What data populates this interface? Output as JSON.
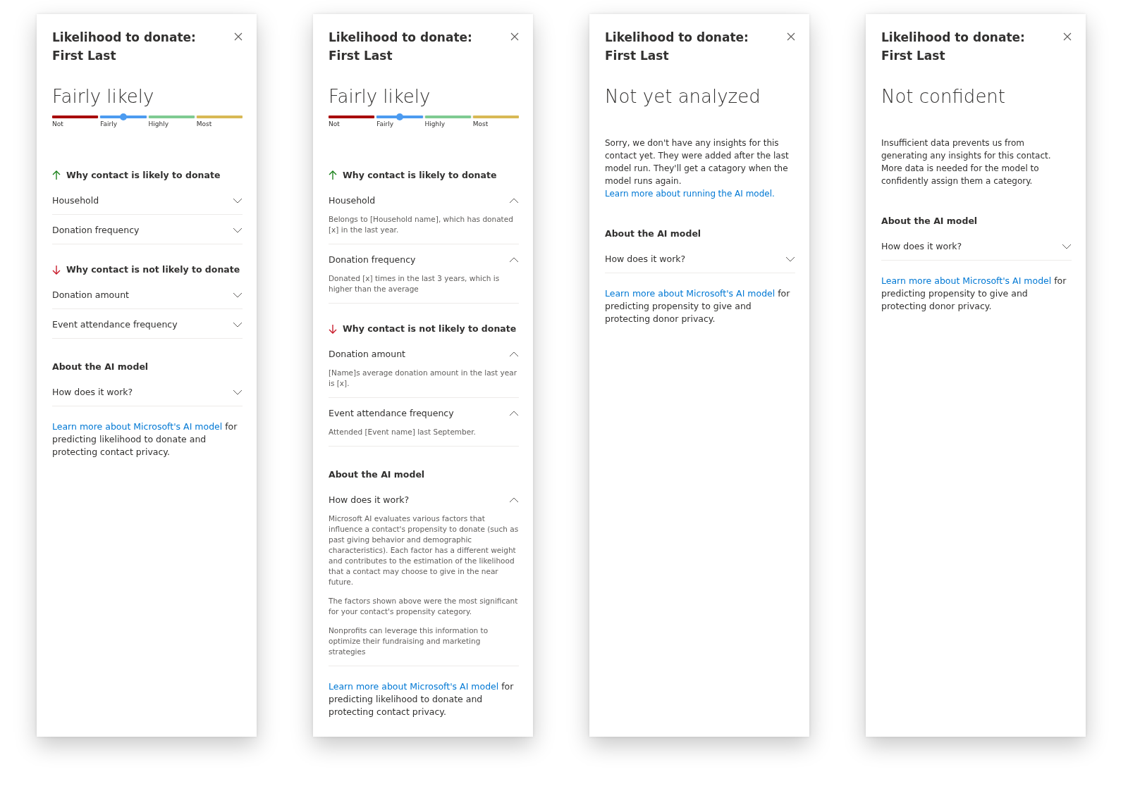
{
  "panels": [
    {
      "title": [
        "Likelihood to donate:",
        "First Last"
      ],
      "status": "Fairly likely",
      "scale": {
        "level": 0.375,
        "segments": [
          {
            "label": "Not",
            "color": "#a80000"
          },
          {
            "label": "Fairly",
            "color": "#4c9bf0"
          },
          {
            "label": "Highly",
            "color": "#7fcb92"
          },
          {
            "label": "Most",
            "color": "#d8b955"
          }
        ]
      },
      "sections": [
        {
          "kind": "likely",
          "heading": "Why contact is likely to donate",
          "items": [
            {
              "label": "Household",
              "expanded": false
            },
            {
              "label": "Donation frequency",
              "expanded": false
            }
          ]
        },
        {
          "kind": "unlikely",
          "heading": "Why contact is not likely to donate",
          "items": [
            {
              "label": "Donation amount",
              "expanded": false
            },
            {
              "label": "Event attendance frequency",
              "expanded": false
            }
          ]
        },
        {
          "kind": "about",
          "heading": "About the AI model",
          "items": [
            {
              "label": "How does it work?",
              "expanded": false
            }
          ]
        }
      ],
      "footer": [
        {
          "kind": "link",
          "text": "Learn more about Microsoft's AI model"
        },
        {
          "kind": "text",
          "text": " for predicting likelihood to donate and protecting contact privacy."
        }
      ]
    },
    {
      "title": [
        "Likelihood to donate:",
        "First Last"
      ],
      "status": "Fairly likely",
      "scale": {
        "level": 0.375,
        "segments": [
          {
            "label": "Not",
            "color": "#a80000"
          },
          {
            "label": "Fairly",
            "color": "#4c9bf0"
          },
          {
            "label": "Highly",
            "color": "#7fcb92"
          },
          {
            "label": "Most",
            "color": "#d8b955"
          }
        ]
      },
      "sections": [
        {
          "kind": "likely",
          "heading": "Why contact is likely to donate",
          "items": [
            {
              "label": "Household",
              "expanded": true,
              "detail": [
                "Belongs to [Household name], which has donated [x] in the last year."
              ]
            },
            {
              "label": "Donation frequency",
              "expanded": true,
              "detail": [
                "Donated [x] times in the last 3 years, which is higher than the average"
              ]
            }
          ]
        },
        {
          "kind": "unlikely",
          "heading": "Why contact is not likely to donate",
          "items": [
            {
              "label": "Donation amount",
              "expanded": true,
              "detail": [
                "[Name]s average donation amount in the last year is [x]."
              ]
            },
            {
              "label": "Event attendance frequency",
              "expanded": true,
              "detail": [
                "Attended [Event name] last September."
              ]
            }
          ]
        },
        {
          "kind": "about",
          "heading": "About the AI model",
          "items": [
            {
              "label": "How does it work?",
              "expanded": true,
              "detail": [
                "Microsoft AI evaluates various factors that influence a contact's propensity to donate (such as past giving behavior and demographic characteristics). Each factor has a different weight and contributes to the estimation of the likelihood that a contact may choose to give in the near future.",
                "The factors shown above were the most significant for your contact's propensity category.",
                "Nonprofits can leverage this information to optimize their fundraising and marketing strategies"
              ]
            }
          ]
        }
      ],
      "footer": [
        {
          "kind": "link",
          "text": "Learn more about Microsoft's AI model"
        },
        {
          "kind": "text",
          "text": " for predicting likelihood to donate and protecting contact privacy."
        }
      ]
    },
    {
      "title": [
        "Likelihood to donate:",
        "First Last"
      ],
      "status": "Not yet analyzed",
      "message": [
        {
          "kind": "text",
          "text": "Sorry, we don't have any insights for this contact yet.  They were added after the last model run. They'll get a catagory when the model runs again. "
        },
        {
          "kind": "link",
          "text": "Learn more about running"
        },
        {
          "kind": "link",
          "text": "the AI model."
        }
      ],
      "sections": [
        {
          "kind": "about",
          "heading": "About the AI model",
          "items": [
            {
              "label": "How does it work?",
              "expanded": false
            }
          ]
        }
      ],
      "footer": [
        {
          "kind": "link",
          "text": "Learn more about Microsoft's AI model"
        },
        {
          "kind": "text",
          "text": " for predicting propensity to give and protecting donor privacy."
        }
      ]
    },
    {
      "title": [
        "Likelihood to donate:",
        "First Last"
      ],
      "status": "Not confident",
      "message": [
        {
          "kind": "text",
          "text": "Insufficient data prevents us from generating any insights for this contact. More data is needed for the model to confidently assign them a category."
        }
      ],
      "sections": [
        {
          "kind": "about",
          "heading": "About the AI model",
          "items": [
            {
              "label": "How does it work?",
              "expanded": false
            }
          ]
        }
      ],
      "footer": [
        {
          "kind": "link",
          "text": "Learn more about Microsoft's AI model"
        },
        {
          "kind": "text",
          "text": " for predicting propensity to give and protecting donor privacy."
        }
      ]
    }
  ]
}
